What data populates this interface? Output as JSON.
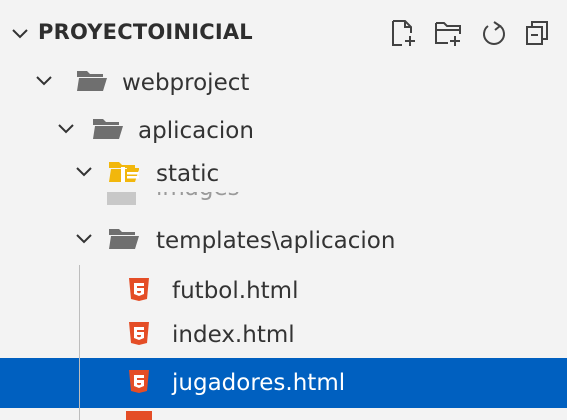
{
  "explorer": {
    "section_title": "PROYECTOINICIAL",
    "header_icons": [
      "new-file-icon",
      "new-folder-icon",
      "refresh-icon",
      "collapse-all-icon"
    ],
    "tree": [
      {
        "label": "webproject",
        "kind": "folder",
        "expanded": true
      },
      {
        "label": "aplicacion",
        "kind": "folder",
        "expanded": true
      },
      {
        "label": "static",
        "kind": "static-folder",
        "expanded": true
      },
      {
        "label": "images",
        "kind": "folder",
        "partially_hidden": true
      },
      {
        "label": "templates\\aplicacion",
        "kind": "folder",
        "expanded": true
      },
      {
        "label": "futbol.html",
        "kind": "html-file"
      },
      {
        "label": "index.html",
        "kind": "html-file"
      },
      {
        "label": "jugadores.html",
        "kind": "html-file",
        "selected": true
      }
    ]
  },
  "colors": {
    "selection": "#0060c0",
    "html_icon": "#e44d26",
    "static_folder": "#f2b70c",
    "folder": "#6f6f6f"
  }
}
